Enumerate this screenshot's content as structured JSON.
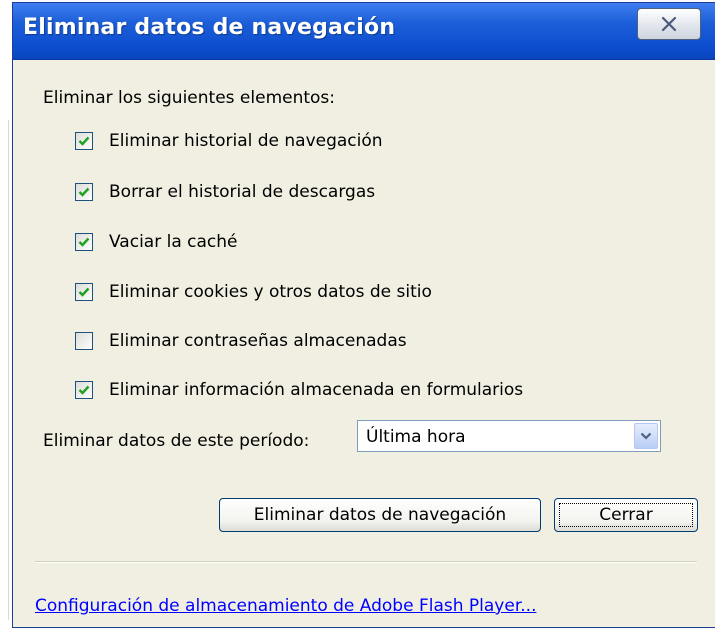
{
  "window": {
    "title": "Eliminar datos de navegación",
    "close_icon": "close-x-icon"
  },
  "section_label": "Eliminar los siguientes elementos:",
  "options": [
    {
      "label": "Eliminar historial de navegación",
      "checked": true
    },
    {
      "label": "Borrar el historial de descargas",
      "checked": true
    },
    {
      "label": "Vaciar la caché",
      "checked": true
    },
    {
      "label": "Eliminar cookies y otros datos de sitio",
      "checked": true
    },
    {
      "label": "Eliminar contraseñas almacenadas",
      "checked": false
    },
    {
      "label": "Eliminar información almacenada en formularios",
      "checked": true
    }
  ],
  "period": {
    "label": "Eliminar datos de este período:",
    "selected": "Última hora"
  },
  "buttons": {
    "clear_label": "Eliminar datos de navegación",
    "close_label": "Cerrar"
  },
  "footer_link": "Configuración de almacenamiento de Adobe Flash Player...",
  "colors": {
    "titlebar": "#0d4fd0",
    "dialog_bg": "#f1efe2",
    "checkmark": "#21a121",
    "link": "#0000ff"
  }
}
